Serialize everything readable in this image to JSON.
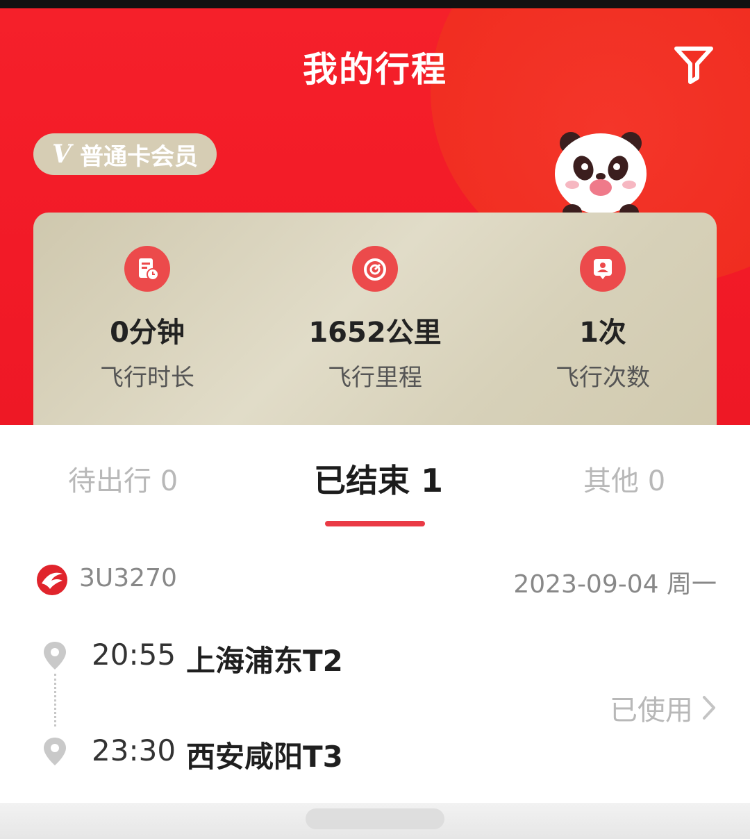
{
  "header": {
    "title": "我的行程"
  },
  "member_badge": {
    "v_mark": "V",
    "label": "普通卡会员"
  },
  "stats": [
    {
      "icon": "flight-time-icon",
      "value": "0分钟",
      "label": "飞行时长"
    },
    {
      "icon": "speedometer-icon",
      "value": "1652公里",
      "label": "飞行里程"
    },
    {
      "icon": "user-card-icon",
      "value": "1次",
      "label": "飞行次数"
    }
  ],
  "tabs": [
    {
      "label": "待出行 0",
      "active": false
    },
    {
      "label": "已结束 1",
      "active": true
    },
    {
      "label": "其他 0",
      "active": false
    }
  ],
  "trip": {
    "flight_no": "3U3270",
    "date": "2023-09-04 周一",
    "departure": {
      "time": "20:55",
      "place": "上海浦东T2"
    },
    "arrival": {
      "time": "23:30",
      "place": "西安咸阳T3"
    },
    "status": "已使用"
  },
  "colors": {
    "brand_red": "#f21a27",
    "accent_red": "#ec4a4b",
    "card_beige": "#d7d1b9"
  }
}
